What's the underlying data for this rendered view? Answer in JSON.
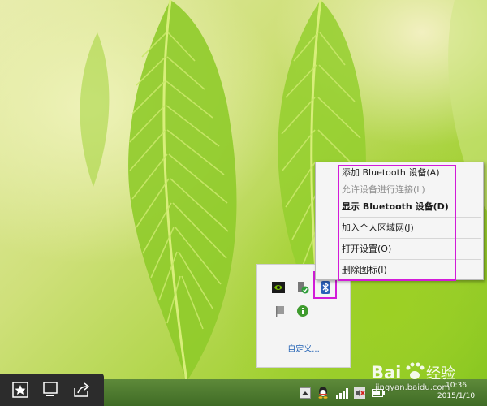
{
  "context_menu": {
    "items": [
      {
        "label": "添加 Bluetooth 设备(A)",
        "state": "enabled"
      },
      {
        "label": "允许设备进行连接(L)",
        "state": "disabled"
      },
      {
        "label": "显示 Bluetooth 设备(D)",
        "state": "default"
      },
      {
        "label": "加入个人区域网(J)",
        "state": "enabled"
      },
      {
        "label": "打开设置(O)",
        "state": "enabled"
      },
      {
        "label": "删除图标(I)",
        "state": "enabled"
      }
    ],
    "highlight_color": "#d21bd8"
  },
  "tray_flyout": {
    "icons": [
      "nvidia-icon",
      "security-shield-icon",
      "bluetooth-icon",
      "flag-icon",
      "info-icon"
    ],
    "customize_label": "自定义..."
  },
  "taskbar": {
    "charm_buttons": [
      "favorites-star-icon",
      "desktop-icon",
      "share-icon"
    ],
    "tray_icons": [
      "show-hidden-icons-arrow",
      "qq-icon",
      "network-signal-icon",
      "volume-muted-icon",
      "power-icon"
    ],
    "clock": {
      "time": "10:36",
      "date": "2015/1/10"
    }
  },
  "watermark": {
    "brand": "Bai du 经验",
    "url": "jingyan.baidu.com"
  }
}
